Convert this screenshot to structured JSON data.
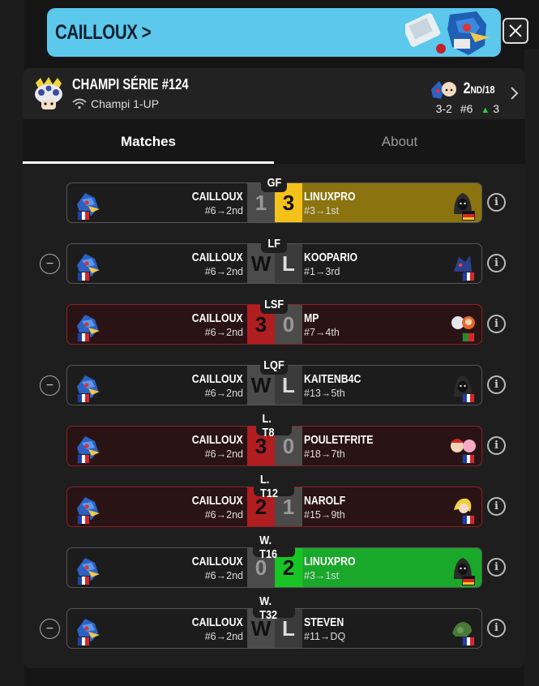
{
  "banner": {
    "player": "CAILLOUX",
    "chevron": ">"
  },
  "close_icon": "close-icon",
  "tournament": {
    "title": "CHAMPI SÉRIE #124",
    "subtitle": "Champi 1-UP",
    "placement": "2",
    "placement_suffix": "ND",
    "placement_total": "/18",
    "record": "3-2",
    "seed": "#6",
    "delta": "3",
    "delta_color": "#2ecc40"
  },
  "tabs": [
    {
      "label": "Matches"
    },
    {
      "label": "About"
    }
  ],
  "matches": [
    {
      "round": "GF",
      "left": {
        "name": "CAILLOUX",
        "seed": "#6→2nd",
        "score": "1"
      },
      "right": {
        "name": "LINUXPRO",
        "seed": "#3→1st",
        "score": "3",
        "flag": "de"
      },
      "result": "gold",
      "dq": false
    },
    {
      "round": "LF",
      "left": {
        "name": "CAILLOUX",
        "seed": "#6→2nd",
        "score": "W"
      },
      "right": {
        "name": "KOOPARIO",
        "seed": "#1→3rd",
        "score": "L",
        "flag": "fr"
      },
      "result": "dq",
      "dq": true
    },
    {
      "round": "LSF",
      "left": {
        "name": "CAILLOUX",
        "seed": "#6→2nd",
        "score": "3"
      },
      "right": {
        "name": "MP",
        "seed": "#7→4th",
        "score": "0",
        "flag": "pt"
      },
      "result": "lose",
      "dq": false
    },
    {
      "round": "LQF",
      "left": {
        "name": "CAILLOUX",
        "seed": "#6→2nd",
        "score": "W"
      },
      "right": {
        "name": "KAITENB4C",
        "seed": "#13→5th",
        "score": "L",
        "flag": "fr"
      },
      "result": "dq",
      "dq": true
    },
    {
      "round": "L. T8",
      "left": {
        "name": "CAILLOUX",
        "seed": "#6→2nd",
        "score": "3"
      },
      "right": {
        "name": "POULETFRITE",
        "seed": "#18→7th",
        "score": "0",
        "flag": "fr"
      },
      "result": "lose",
      "dq": false
    },
    {
      "round": "L. T12",
      "left": {
        "name": "CAILLOUX",
        "seed": "#6→2nd",
        "score": "2"
      },
      "right": {
        "name": "NAROLF",
        "seed": "#15→9th",
        "score": "1",
        "flag": "fr"
      },
      "result": "lose",
      "dq": false
    },
    {
      "round": "W. T16",
      "left": {
        "name": "CAILLOUX",
        "seed": "#6→2nd",
        "score": "0"
      },
      "right": {
        "name": "LINUXPRO",
        "seed": "#3→1st",
        "score": "2",
        "flag": "de"
      },
      "result": "win",
      "dq": false
    },
    {
      "round": "W. T32",
      "left": {
        "name": "CAILLOUX",
        "seed": "#6→2nd",
        "score": "W"
      },
      "right": {
        "name": "STEVEN",
        "seed": "#11→DQ",
        "score": "L",
        "flag": "fr"
      },
      "result": "dq",
      "dq": true
    }
  ],
  "colors": {
    "gold": "#f4c21a",
    "red": "#b01e22",
    "green": "#19c425",
    "banner": "#5bc8ec"
  }
}
